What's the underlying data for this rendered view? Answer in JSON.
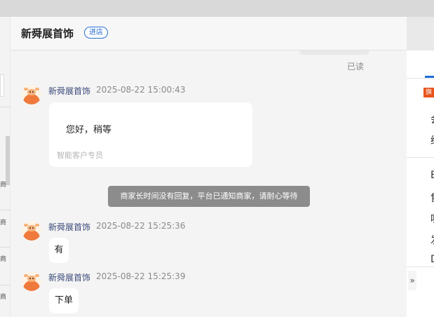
{
  "header": {
    "title": "新舜展首饰",
    "tag": "进店"
  },
  "conversation": {
    "read_status": "已读",
    "messages": [
      {
        "sender": "新舜展首饰",
        "time": "2025-08-22 15:00:43",
        "text": "您好，稍等",
        "signature": "智能客户专员"
      },
      {
        "sender": "新舜展首饰",
        "time": "2025-08-22 15:25:36",
        "text": "有"
      },
      {
        "sender": "新舜展首饰",
        "time": "2025-08-22 15:25:39",
        "text": "下单"
      }
    ],
    "system_notice": "商家长时间没有回复，平台已通知商家，请耐心等待"
  },
  "right_panel": {
    "badge": "旗",
    "chars": [
      "会",
      "经",
      "E",
      "售",
      "呢",
      "发",
      "D"
    ],
    "collapse_icon": "double-chevron-right-icon"
  },
  "left_panel": {
    "ticks": [
      "商",
      "商",
      "商",
      "商"
    ]
  }
}
